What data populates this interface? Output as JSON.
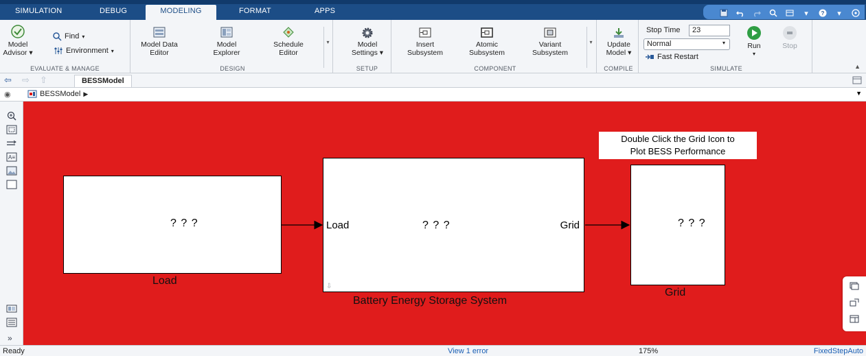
{
  "tabs": [
    "SIMULATION",
    "DEBUG",
    "MODELING",
    "FORMAT",
    "APPS"
  ],
  "active_tab": "MODELING",
  "ribbon": {
    "evaluate": {
      "model_advisor_line1": "Model",
      "model_advisor_line2": "Advisor",
      "find": "Find",
      "environment": "Environment",
      "label": "EVALUATE & MANAGE"
    },
    "design": {
      "model_data_editor_1": "Model Data",
      "model_data_editor_2": "Editor",
      "model_explorer_1": "Model",
      "model_explorer_2": "Explorer",
      "schedule_editor_1": "Schedule",
      "schedule_editor_2": "Editor",
      "label": "DESIGN"
    },
    "setup": {
      "model_settings_1": "Model",
      "model_settings_2": "Settings",
      "label": "SETUP"
    },
    "component": {
      "insert_subsystem_1": "Insert",
      "insert_subsystem_2": "Subsystem",
      "atomic_subsystem_1": "Atomic",
      "atomic_subsystem_2": "Subsystem",
      "variant_subsystem_1": "Variant",
      "variant_subsystem_2": "Subsystem",
      "label": "COMPONENT"
    },
    "compile": {
      "update_model_1": "Update",
      "update_model_2": "Model",
      "label": "COMPILE"
    },
    "simulate": {
      "stop_time_label": "Stop Time",
      "stop_time_value": "23",
      "mode_value": "Normal",
      "fast_restart": "Fast Restart",
      "run": "Run",
      "stop": "Stop",
      "label": "SIMULATE"
    }
  },
  "model_tab": "BESSModel",
  "breadcrumb": "BESSModel",
  "canvas": {
    "load_block_text": "? ? ?",
    "load_block_name": "Load",
    "bess_block_text": "? ? ?",
    "bess_port_in": "Load",
    "bess_port_out": "Grid",
    "bess_block_name": "Battery Energy Storage System",
    "grid_block_text": "? ? ?",
    "grid_block_name": "Grid",
    "note_line1": "Double Click the Grid Icon to",
    "note_line2": "Plot BESS Performance",
    "background_color": "#e01c1c"
  },
  "status": {
    "ready": "Ready",
    "view_errors": "View 1 error",
    "zoom": "175%",
    "solver": "FixedStepAuto"
  }
}
